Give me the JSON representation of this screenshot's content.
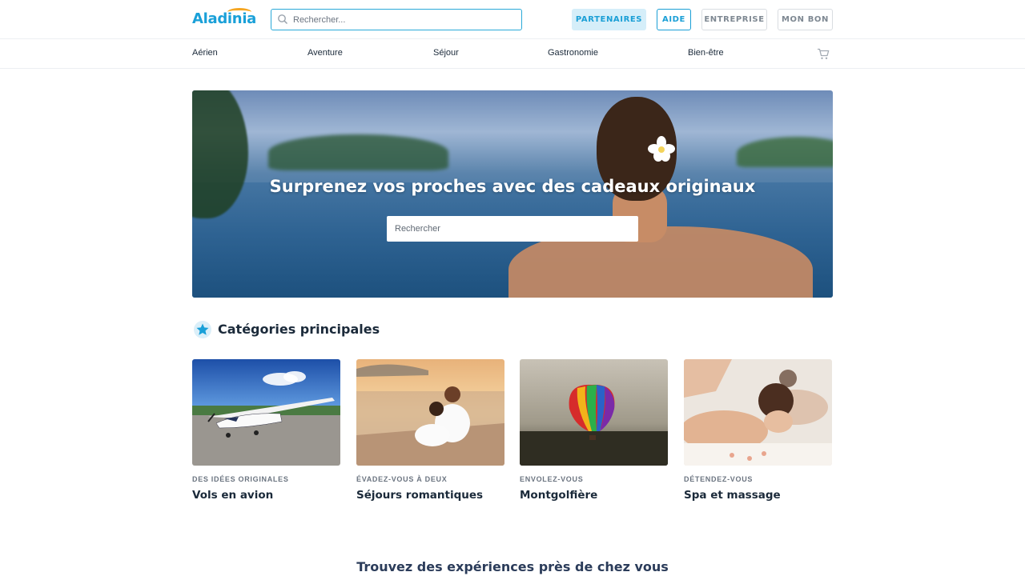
{
  "header": {
    "logo": "Aladinia",
    "search_placeholder": "Rechercher...",
    "buttons": {
      "partners": "PARTENAIRES",
      "help": "AIDE",
      "business": "ENTREPRISE",
      "voucher": "MON BON"
    }
  },
  "nav": {
    "items": [
      "Aérien",
      "Aventure",
      "Séjour",
      "Gastronomie",
      "Bien-être"
    ]
  },
  "hero": {
    "title": "Surprenez vos proches avec des cadeaux originaux",
    "search_placeholder": "Rechercher"
  },
  "categories": {
    "title": "Catégories principales",
    "cards": [
      {
        "kicker": "DES IDÉES ORIGINALES",
        "title": "Vols en avion"
      },
      {
        "kicker": "ÉVADEZ-VOUS À DEUX",
        "title": "Séjours romantiques"
      },
      {
        "kicker": "ENVOLEZ-VOUS",
        "title": "Montgolfière"
      },
      {
        "kicker": "DÉTENDEZ-VOUS",
        "title": "Spa et massage"
      }
    ]
  },
  "nearby": {
    "title": "Trouvez des expériences près de chez vous"
  },
  "colors": {
    "accent": "#1aa0d8",
    "logo_arc": "#f5a623",
    "text_dark": "#1b2a3a"
  }
}
